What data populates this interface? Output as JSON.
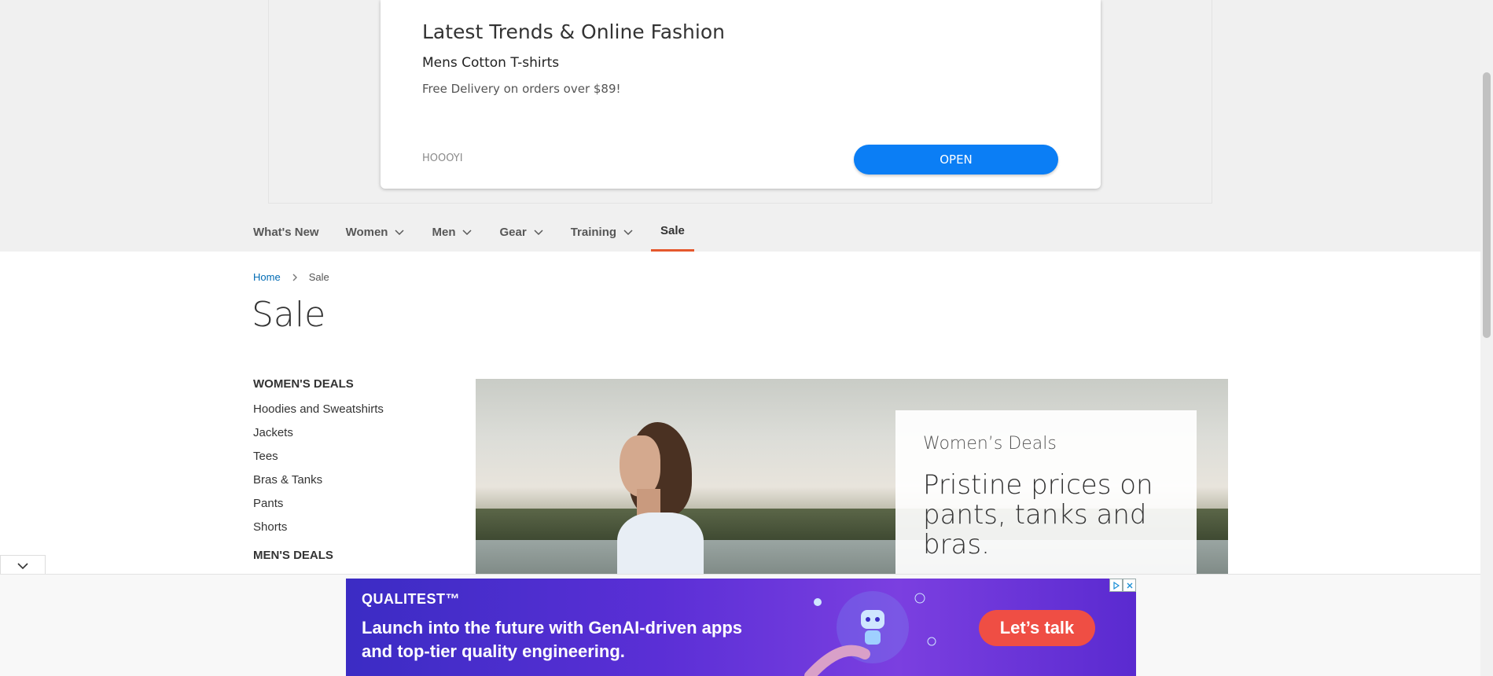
{
  "top_ad": {
    "title": "Latest Trends & Online Fashion",
    "subtitle": "Mens Cotton T-shirts",
    "description": "Free Delivery on orders over $89!",
    "brand": "HOOOYI",
    "cta": "OPEN",
    "cta_color": "#0b7ef5"
  },
  "nav": {
    "items": [
      {
        "label": "What's New"
      },
      {
        "label": "Women"
      },
      {
        "label": "Men"
      },
      {
        "label": "Gear"
      },
      {
        "label": "Training"
      },
      {
        "label": "Sale"
      }
    ],
    "active_color": "#e5582d"
  },
  "breadcrumb": {
    "home": "Home",
    "separator_icon": "chevron-right-icon",
    "current": "Sale"
  },
  "page_title": "Sale",
  "sidebar": {
    "womens_heading": "WOMEN'S DEALS",
    "womens_links": [
      "Hoodies and Sweatshirts",
      "Jackets",
      "Tees",
      "Bras & Tanks",
      "Pants",
      "Shorts"
    ],
    "mens_heading": "MEN'S DEALS"
  },
  "hero": {
    "kicker": "Women’s Deals",
    "headline": "Pristine prices on pants, tanks and bras."
  },
  "bottom_ad": {
    "brand": "QUALITEST™",
    "text": "Launch into the future with GenAI-driven apps and top-tier quality engineering.",
    "cta": "Let’s talk",
    "cta_color": "#ef4e44"
  }
}
